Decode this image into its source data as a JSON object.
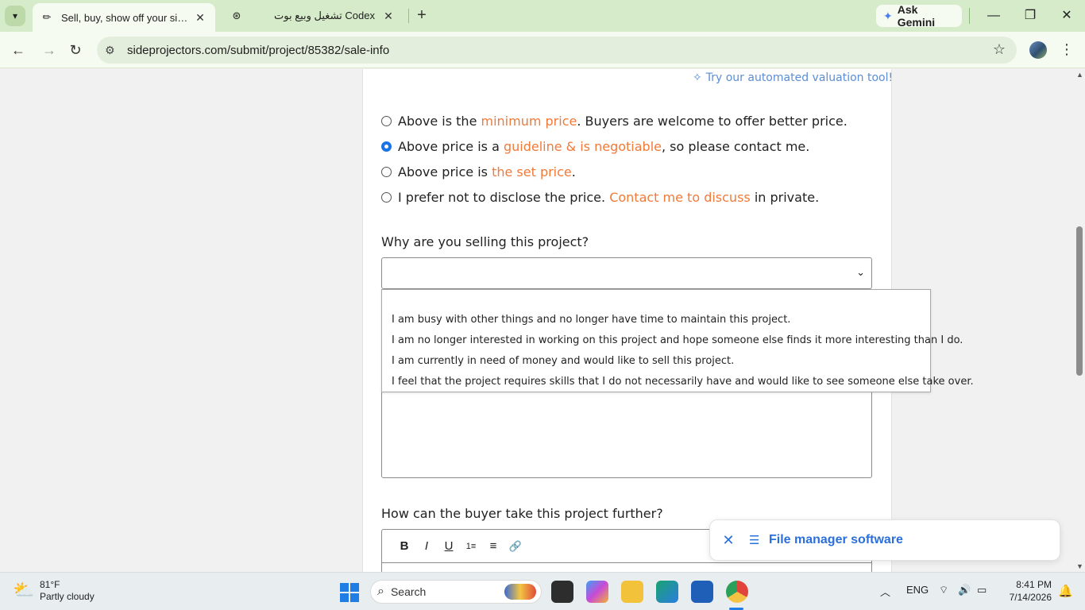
{
  "browser": {
    "tabs": [
      {
        "title": "Sell, buy, show off your side pro",
        "active": true,
        "favicon": "pencil-icon"
      },
      {
        "title": "تشغيل وبيع بوت Codex",
        "active": false,
        "favicon": "openai-icon"
      }
    ],
    "ask_gemini": "Ask Gemini",
    "url": "sideprojectors.com/submit/project/85382/sale-info"
  },
  "page": {
    "valuation_link": "Try our automated valuation tool!",
    "price_options": [
      {
        "before": "Above is the ",
        "highlight": "minimum price",
        "after": ". Buyers are welcome to offer better price.",
        "checked": false
      },
      {
        "before": "Above price is a ",
        "highlight": "guideline & is negotiable",
        "after": ", so please contact me.",
        "checked": true
      },
      {
        "before": "Above price is ",
        "highlight": "the set price",
        "after": ".",
        "checked": false
      },
      {
        "before": "I prefer not to disclose the price. ",
        "highlight": "Contact me to discuss",
        "after": " in private.",
        "checked": false
      }
    ],
    "why_selling_label": "Why are you selling this project?",
    "why_selling_selected": "",
    "why_selling_options": [
      "",
      "I am busy with other things and no longer have time to maintain this project.",
      "I am no longer interested in working on this project and hope someone else finds it more interesting than I do.",
      "I am currently in need of money and would like to sell this project.",
      "I feel that the project requires skills that I do not necessarily have and would like to see someone else take over."
    ],
    "further_label": "How can the buyer take this project further?",
    "editor_tools": [
      "B",
      "I",
      "U",
      "1≡",
      "≡",
      "🔗"
    ]
  },
  "toast": {
    "label": "File manager software"
  },
  "taskbar": {
    "weather_temp": "81°F",
    "weather_desc": "Partly cloudy",
    "search_placeholder": "Search",
    "lang": "ENG",
    "time": "8:41 PM",
    "date": "7/14/2026"
  },
  "colors": {
    "highlight": "#f07a3a",
    "link": "#5b8dd6",
    "tab_strip": "#d6ebc9",
    "toast_text": "#2a6fdb"
  }
}
